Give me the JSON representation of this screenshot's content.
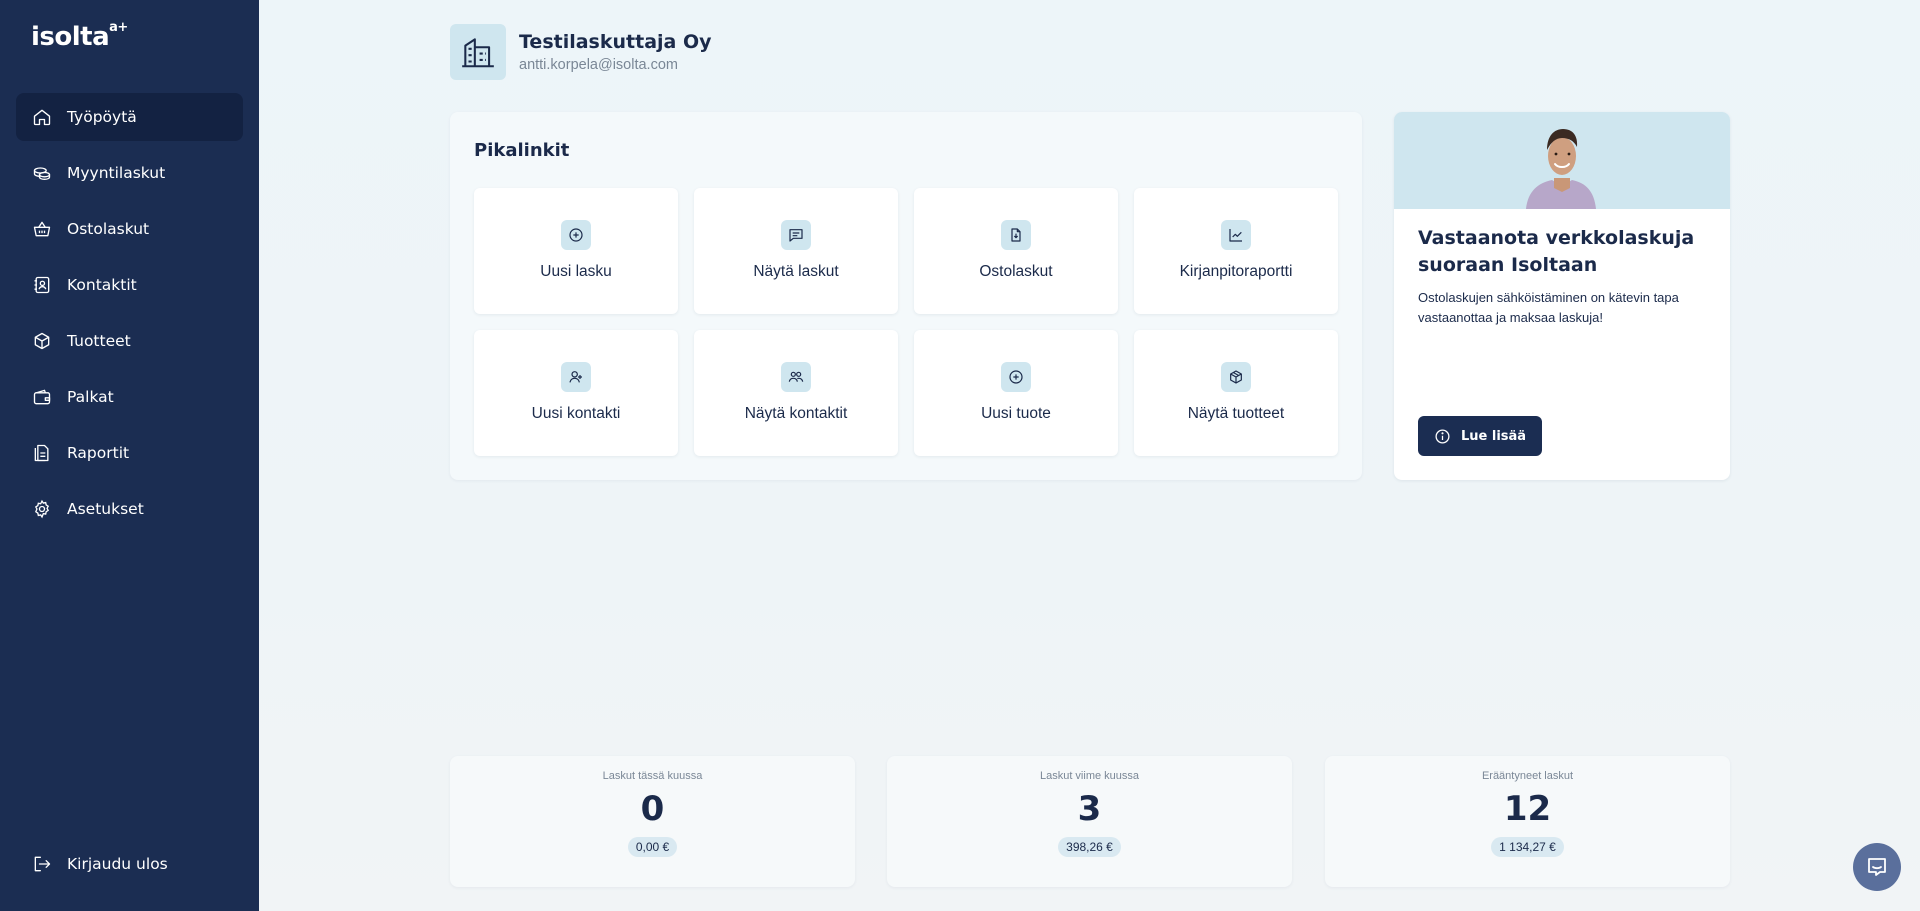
{
  "brand": {
    "name": "isolta",
    "superscript": "a+"
  },
  "sidebar": {
    "items": [
      {
        "label": "Työpöytä",
        "icon": "home-icon",
        "active": true
      },
      {
        "label": "Myyntilaskut",
        "icon": "coins-icon",
        "active": false
      },
      {
        "label": "Ostolaskut",
        "icon": "basket-icon",
        "active": false
      },
      {
        "label": "Kontaktit",
        "icon": "contact-book-icon",
        "active": false
      },
      {
        "label": "Tuotteet",
        "icon": "package-icon",
        "active": false
      },
      {
        "label": "Palkat",
        "icon": "wallet-icon",
        "active": false
      },
      {
        "label": "Raportit",
        "icon": "document-icon",
        "active": false
      },
      {
        "label": "Asetukset",
        "icon": "gear-icon",
        "active": false
      }
    ],
    "logout_label": "Kirjaudu ulos"
  },
  "company": {
    "name": "Testilaskuttaja Oy",
    "email": "antti.korpela@isolta.com"
  },
  "quicklinks": {
    "title": "Pikalinkit",
    "tiles": [
      {
        "label": "Uusi lasku",
        "icon": "plus-circle-icon"
      },
      {
        "label": "Näytä laskut",
        "icon": "message-list-icon"
      },
      {
        "label": "Ostolaskut",
        "icon": "file-download-icon"
      },
      {
        "label": "Kirjanpitoraportti",
        "icon": "chart-line-icon"
      },
      {
        "label": "Uusi kontakti",
        "icon": "user-plus-icon"
      },
      {
        "label": "Näytä kontaktit",
        "icon": "users-icon"
      },
      {
        "label": "Uusi tuote",
        "icon": "plus-circle-icon"
      },
      {
        "label": "Näytä tuotteet",
        "icon": "box-icon"
      }
    ]
  },
  "promo": {
    "title": "Vastaanota verkkolaskuja suoraan Isoltaan",
    "text": "Ostolaskujen sähköistäminen on kätevin tapa vastaanottaa ja maksaa laskuja!",
    "button_label": "Lue lisää"
  },
  "stats": [
    {
      "label": "Laskut tässä kuussa",
      "value": "0",
      "amount": "0,00 €"
    },
    {
      "label": "Laskut viime kuussa",
      "value": "3",
      "amount": "398,26 €"
    },
    {
      "label": "Erääntyneet laskut",
      "value": "12",
      "amount": "1 134,27 €"
    }
  ],
  "colors": {
    "sidebar_bg": "#1b2d52",
    "sidebar_active": "#132242",
    "accent_light": "#cfe6ef",
    "text_dark": "#1b2a4a"
  }
}
